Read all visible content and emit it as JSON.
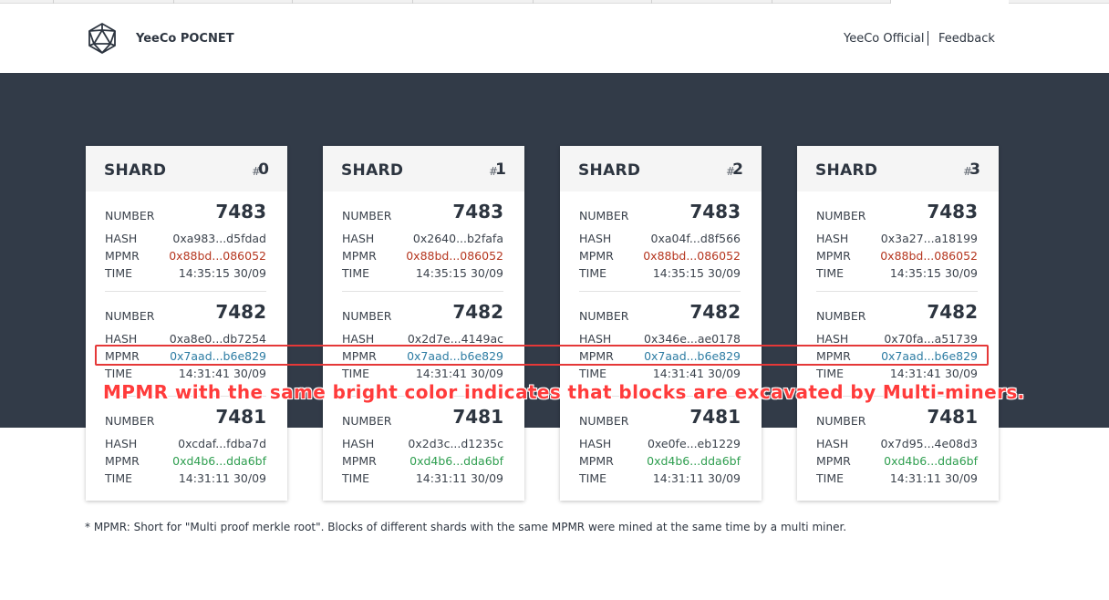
{
  "header": {
    "brand": "YeeCo POCNET",
    "nav_official": "YeeCo Official",
    "nav_feedback": "Feedback"
  },
  "shards": [
    {
      "title": "SHARD",
      "hash_sign": "#",
      "index": "0",
      "blocks": [
        {
          "number_label": "NUMBER",
          "number": "7483",
          "hash_label": "HASH",
          "hash": "0xa983...d5fdad",
          "mpmr_label": "MPMR",
          "mpmr": "0x88bd...086052",
          "time_label": "TIME",
          "time": "14:35:15 30/09"
        },
        {
          "number_label": "NUMBER",
          "number": "7482",
          "hash_label": "HASH",
          "hash": "0xa8e0...db7254",
          "mpmr_label": "MPMR",
          "mpmr": "0x7aad...b6e829",
          "time_label": "TIME",
          "time": "14:31:41 30/09"
        },
        {
          "number_label": "NUMBER",
          "number": "7481",
          "hash_label": "HASH",
          "hash": "0xcdaf...fdba7d",
          "mpmr_label": "MPMR",
          "mpmr": "0xd4b6...dda6bf",
          "time_label": "TIME",
          "time": "14:31:11 30/09"
        }
      ]
    },
    {
      "title": "SHARD",
      "hash_sign": "#",
      "index": "1",
      "blocks": [
        {
          "number_label": "NUMBER",
          "number": "7483",
          "hash_label": "HASH",
          "hash": "0x2640...b2fafa",
          "mpmr_label": "MPMR",
          "mpmr": "0x88bd...086052",
          "time_label": "TIME",
          "time": "14:35:15 30/09"
        },
        {
          "number_label": "NUMBER",
          "number": "7482",
          "hash_label": "HASH",
          "hash": "0x2d7e...4149ac",
          "mpmr_label": "MPMR",
          "mpmr": "0x7aad...b6e829",
          "time_label": "TIME",
          "time": "14:31:41 30/09"
        },
        {
          "number_label": "NUMBER",
          "number": "7481",
          "hash_label": "HASH",
          "hash": "0x2d3c...d1235c",
          "mpmr_label": "MPMR",
          "mpmr": "0xd4b6...dda6bf",
          "time_label": "TIME",
          "time": "14:31:11 30/09"
        }
      ]
    },
    {
      "title": "SHARD",
      "hash_sign": "#",
      "index": "2",
      "blocks": [
        {
          "number_label": "NUMBER",
          "number": "7483",
          "hash_label": "HASH",
          "hash": "0xa04f...d8f566",
          "mpmr_label": "MPMR",
          "mpmr": "0x88bd...086052",
          "time_label": "TIME",
          "time": "14:35:15 30/09"
        },
        {
          "number_label": "NUMBER",
          "number": "7482",
          "hash_label": "HASH",
          "hash": "0x346e...ae0178",
          "mpmr_label": "MPMR",
          "mpmr": "0x7aad...b6e829",
          "time_label": "TIME",
          "time": "14:31:41 30/09"
        },
        {
          "number_label": "NUMBER",
          "number": "7481",
          "hash_label": "HASH",
          "hash": "0xe0fe...eb1229",
          "mpmr_label": "MPMR",
          "mpmr": "0xd4b6...dda6bf",
          "time_label": "TIME",
          "time": "14:31:11 30/09"
        }
      ]
    },
    {
      "title": "SHARD",
      "hash_sign": "#",
      "index": "3",
      "blocks": [
        {
          "number_label": "NUMBER",
          "number": "7483",
          "hash_label": "HASH",
          "hash": "0x3a27...a18199",
          "mpmr_label": "MPMR",
          "mpmr": "0x88bd...086052",
          "time_label": "TIME",
          "time": "14:35:15 30/09"
        },
        {
          "number_label": "NUMBER",
          "number": "7482",
          "hash_label": "HASH",
          "hash": "0x70fa...a51739",
          "mpmr_label": "MPMR",
          "mpmr": "0x7aad...b6e829",
          "time_label": "TIME",
          "time": "14:31:41 30/09"
        },
        {
          "number_label": "NUMBER",
          "number": "7481",
          "hash_label": "HASH",
          "hash": "0x7d95...4e08d3",
          "mpmr_label": "MPMR",
          "mpmr": "0xd4b6...dda6bf",
          "time_label": "TIME",
          "time": "14:31:11 30/09"
        }
      ]
    }
  ],
  "annotation": "MPMR with the same bright color indicates that blocks are excavated by Multi-miners.",
  "footnote": "* MPMR: Short for \"Multi proof merkle root\". Blocks of different shards with the same MPMR were mined at the same time by a multi miner.",
  "colors": {
    "band": "#323b48",
    "mpmr_red": "#b5361f",
    "mpmr_blue": "#2d7ca3",
    "mpmr_green": "#2e9e4f",
    "annotation_red": "#ff3b3b"
  },
  "icons": {
    "logo": "icosahedron-logo-icon"
  }
}
